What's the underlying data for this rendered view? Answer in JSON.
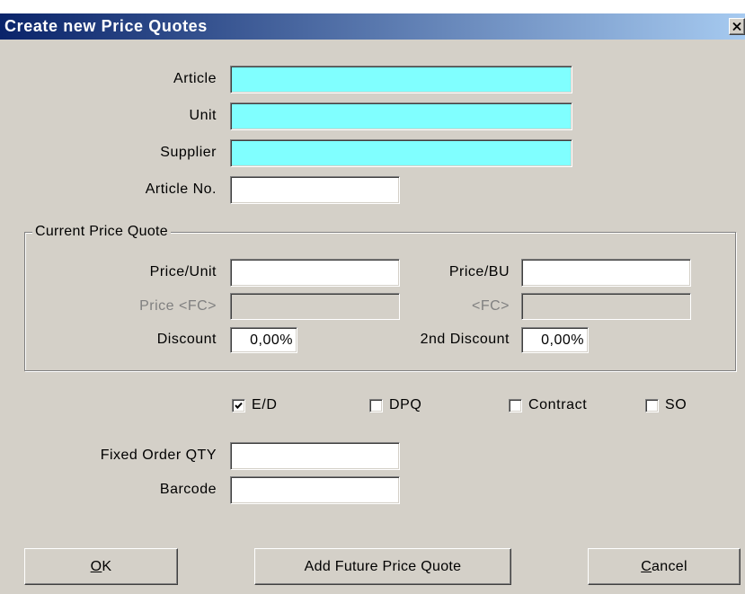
{
  "window": {
    "title": "Create new Price Quotes",
    "close_icon": "close-icon"
  },
  "fields": {
    "article": {
      "label": "Article",
      "value": ""
    },
    "unit": {
      "label": "Unit",
      "value": ""
    },
    "supplier": {
      "label": "Supplier",
      "value": ""
    },
    "article_no": {
      "label": "Article No.",
      "value": ""
    }
  },
  "current_price_quote": {
    "legend": "Current Price Quote",
    "price_unit": {
      "label": "Price/Unit",
      "value": ""
    },
    "price_bu": {
      "label": "Price/BU",
      "value": ""
    },
    "price_fc": {
      "label": "Price <FC>",
      "value": "",
      "disabled": true
    },
    "fc": {
      "label": "<FC>",
      "value": "",
      "disabled": true
    },
    "discount": {
      "label": "Discount",
      "value": "0,00%"
    },
    "second_discount": {
      "label": "2nd Discount",
      "value": "0,00%"
    }
  },
  "options": [
    {
      "label": "E/D",
      "checked": true
    },
    {
      "label": "DPQ",
      "checked": false
    },
    {
      "label": "Contract",
      "checked": false
    },
    {
      "label": "SO",
      "checked": false
    }
  ],
  "order": {
    "fixed_order_qty": {
      "label": "Fixed Order QTY",
      "value": ""
    },
    "barcode": {
      "label": "Barcode",
      "value": ""
    }
  },
  "buttons": {
    "ok": "OK",
    "add_future_price_quote": "Add Future Price Quote",
    "cancel": "Cancel"
  },
  "colors": {
    "dialog_bg": "#d4d0c8",
    "title_start": "#0a246a",
    "title_end": "#a6caf0",
    "title_text": "#ffffff",
    "required_field_bg": "#80ffff",
    "field_bg": "#ffffff",
    "disabled_text": "#808080"
  }
}
